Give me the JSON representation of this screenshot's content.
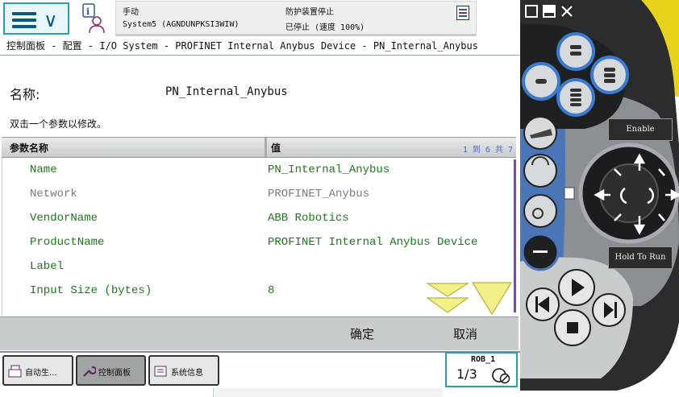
{
  "topbar": {
    "mode_label": "手动",
    "system_name": "System5 (AGNDUNPKSI3WIW)",
    "safety_label": "防护装置停止",
    "state_label": "已停止 (速度 100%)"
  },
  "breadcrumb": "控制面板 - 配置 - I/O System - PROFINET Internal Anybus Device - PN_Internal_Anybus",
  "name_label": "名称:",
  "name_value": "PN_Internal_Anybus",
  "hint": "双击一个参数以修改。",
  "table": {
    "col1_header": "参数名称",
    "col2_header": "值",
    "pager": "1 到 6 共 7",
    "rows": [
      {
        "name": "Name",
        "value": "PN_Internal_Anybus",
        "editable": true
      },
      {
        "name": "Network",
        "value": "PROFINET_Anybus",
        "editable": false
      },
      {
        "name": "VendorName",
        "value": "ABB Robotics",
        "editable": true
      },
      {
        "name": "ProductName",
        "value": "PROFINET Internal Anybus Device",
        "editable": true
      },
      {
        "name": "Label",
        "value": "",
        "editable": true
      },
      {
        "name": "Input Size (bytes)",
        "value": "8",
        "editable": true
      }
    ]
  },
  "actions": {
    "ok_label": "确定",
    "cancel_label": "取消"
  },
  "taskbar": {
    "items": [
      {
        "label": "自动生..."
      },
      {
        "label": "控制面板"
      },
      {
        "label": "系统信息"
      }
    ],
    "rob_label": "ROB_1",
    "rob_fraction": "1/3"
  },
  "pendant": {
    "enable_label": "Enable",
    "hold_label": "Hold To Run"
  },
  "colors": {
    "editable_text": "#1a7a1a",
    "readonly_text": "#7a7a7a",
    "accent": "#2a9fb0",
    "scrollbar": "#8040c8"
  }
}
